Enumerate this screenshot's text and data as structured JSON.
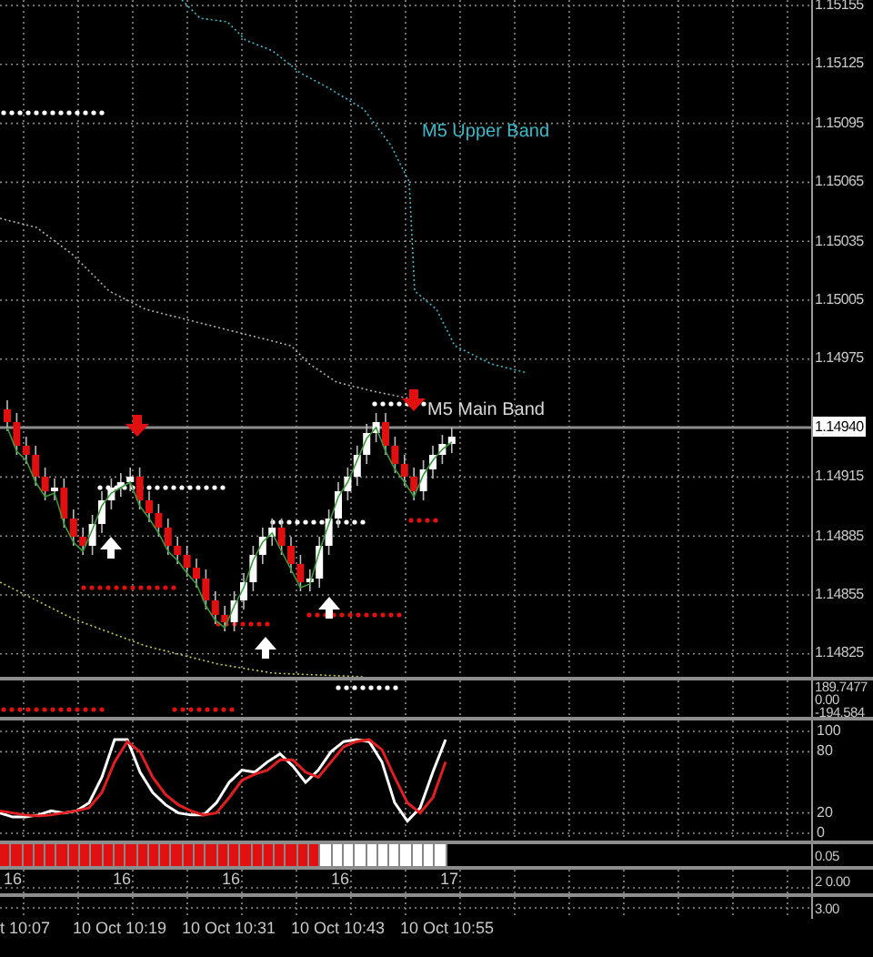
{
  "price_axis": {
    "labels": [
      "1.15155",
      "1.15125",
      "1.15095",
      "1.15065",
      "1.15035",
      "1.15005",
      "1.14975",
      "1.14915",
      "1.14885",
      "1.14855",
      "1.14825"
    ],
    "current_price": "1.14940"
  },
  "band_labels": [
    {
      "text": "M5 Upper Band",
      "color": "#3fb8c8"
    },
    {
      "text": "M5 Main Band",
      "color": "#d8d8d8"
    }
  ],
  "indicator_axis": [
    "189.7477",
    "0.00",
    "-194.584"
  ],
  "stochastic": {
    "chart_data": {
      "type": "line",
      "yticks": [
        {
          "value": 0,
          "label": "0"
        },
        {
          "value": 20,
          "label": "20"
        },
        {
          "value": 80,
          "label": "80"
        },
        {
          "value": 100,
          "label": "100"
        }
      ],
      "grid": true,
      "ylim": [
        -7.1,
        110.7
      ],
      "series": [
        {
          "color": "#ffffff",
          "values": [
            20,
            16,
            16,
            18,
            22,
            20,
            22,
            30,
            55,
            92,
            92,
            60,
            40,
            28,
            20,
            18,
            18,
            30,
            50,
            62,
            60,
            70,
            78,
            66,
            50,
            62,
            80,
            90,
            92,
            90,
            70,
            30,
            12,
            25,
            60,
            92
          ]
        },
        {
          "color": "#e02020",
          "values": [
            22,
            20,
            18,
            17,
            18,
            20,
            22,
            25,
            40,
            70,
            90,
            80,
            55,
            38,
            28,
            22,
            18,
            20,
            35,
            52,
            58,
            62,
            72,
            72,
            60,
            55,
            70,
            85,
            90,
            92,
            82,
            55,
            30,
            20,
            35,
            70
          ]
        }
      ]
    }
  },
  "histogram": {
    "level": 0.72,
    "axis_label": "0.05"
  },
  "day_labels": [
    "16",
    "16",
    "16",
    "16",
    "17"
  ],
  "panel5_axis": [
    "2",
    "0.00"
  ],
  "panel6_axis": [
    "3.00"
  ],
  "time_axis": [
    "t 10:07",
    "10 Oct 10:19",
    "10 Oct 10:31",
    "10 Oct 10:43",
    "10 Oct 10:55"
  ]
}
